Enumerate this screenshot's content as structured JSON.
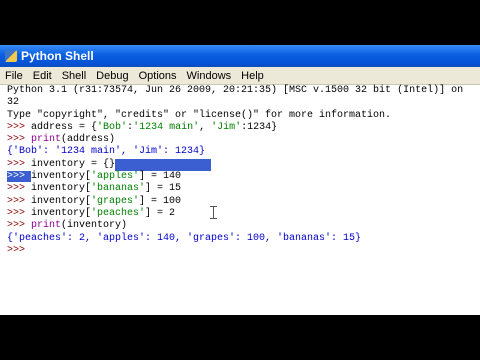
{
  "window": {
    "title": "Python Shell"
  },
  "menu": [
    "File",
    "Edit",
    "Shell",
    "Debug",
    "Options",
    "Windows",
    "Help"
  ],
  "shell": {
    "banner1": "Python 3.1 (r31:73574, Jun 26 2009, 20:21:35) [MSC v.1500 32 bit (Intel)] on",
    "banner2": "32",
    "banner3": "Type \"copyright\", \"credits\" or \"license()\" for more information.",
    "prompt": ">>> ",
    "l1_a": "address = {",
    "l1_s1": "'Bob'",
    "l1_b": ":",
    "l1_s2": "'1234 main'",
    "l1_c": ", ",
    "l1_s3": "'Jim'",
    "l1_d": ":1234}",
    "l2_fn": "print",
    "l2_b": "(address)",
    "out1": "{'Bob': '1234 main', 'Jim': 1234}",
    "l3": "inventory = {}",
    "l4_a": "inventory[",
    "l4_s": "'apples'",
    "l4_b": "] = 140",
    "l5_a": "inventory[",
    "l5_s": "'bananas'",
    "l5_b": "] = 15",
    "l6_a": "inventory[",
    "l6_s": "'grapes'",
    "l6_b": "] = 100",
    "l7_a": "inventory[",
    "l7_s": "'peaches'",
    "l7_b": "] = 2",
    "l8_fn": "print",
    "l8_b": "(inventory)",
    "out2": "{'peaches': 2, 'apples': 140, 'grapes': 100, 'bananas': 15}"
  }
}
